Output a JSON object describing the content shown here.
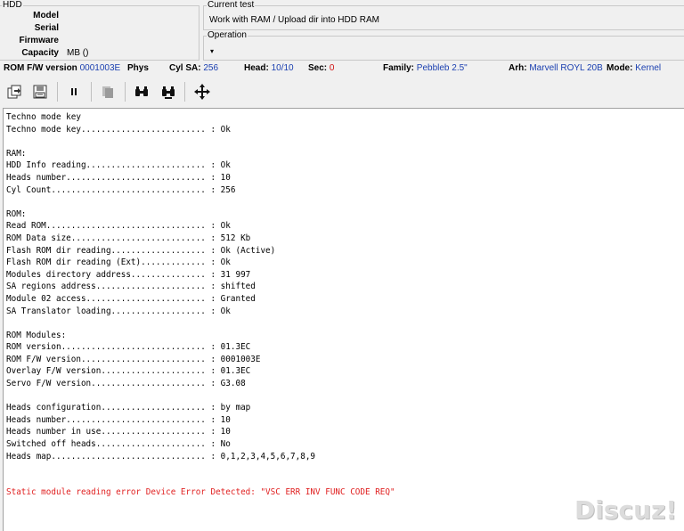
{
  "hdd": {
    "title": "HDD",
    "model_label": "Model",
    "serial_label": "Serial",
    "firmware_label": "Firmware",
    "capacity_label": "Capacity",
    "capacity_value": "MB ()"
  },
  "current_test": {
    "title": "Current test",
    "value": "Work with RAM / Upload dir into HDD RAM"
  },
  "operation": {
    "title": "Operation"
  },
  "status": {
    "rom_fw_label": "ROM F/W version",
    "rom_fw_value": "0001003E",
    "phys_label": "Phys",
    "cyl_sa_label": "Cyl SA:",
    "cyl_sa_value": "256",
    "head_label": "Head:",
    "head_value": "10/10",
    "sec_label": "Sec:",
    "sec_value": "0",
    "family_label": "Family:",
    "family_value": "Pebbleb 2.5\"",
    "arh_label": "Arh:",
    "arh_value": "Marvell ROYL 20B",
    "mode_label": "Mode:",
    "mode_value": "Kernel"
  },
  "toolbar": {
    "icons": [
      "open-icon",
      "save-icon",
      "pause-icon",
      "copy-icon",
      "find-icon",
      "find-next-icon",
      "move-icon"
    ]
  },
  "log": {
    "lines": [
      "Techno mode key",
      "Techno mode key......................... : Ok",
      "",
      "RAM:",
      "HDD Info reading........................ : Ok",
      "Heads number............................ : 10",
      "Cyl Count............................... : 256",
      "",
      "ROM:",
      "Read ROM................................ : Ok",
      "ROM Data size........................... : 512 Kb",
      "Flash ROM dir reading................... : Ok (Active)",
      "Flash ROM dir reading (Ext)............. : Ok",
      "Modules directory address............... : 31 997",
      "SA regions address...................... : shifted",
      "Module 02 access........................ : Granted",
      "SA Translator loading................... : Ok",
      "",
      "ROM Modules:",
      "ROM version............................. : 01.3EC",
      "ROM F/W version......................... : 0001003E",
      "Overlay F/W version..................... : 01.3EC",
      "Servo F/W version....................... : G3.08",
      "",
      "Heads configuration..................... : by map",
      "Heads number............................ : 10",
      "Heads number in use..................... : 10",
      "Switched off heads...................... : No",
      "Heads map............................... : 0,1,2,3,4,5,6,7,8,9",
      "",
      "",
      "Static module reading error Device Error Detected: \"VSC ERR INV FUNC CODE REQ\""
    ],
    "error_line_index": 31
  },
  "watermark": "Discuz!",
  "colors": {
    "accent_blue": "#1a3fb0",
    "error_red": "#e02020"
  }
}
